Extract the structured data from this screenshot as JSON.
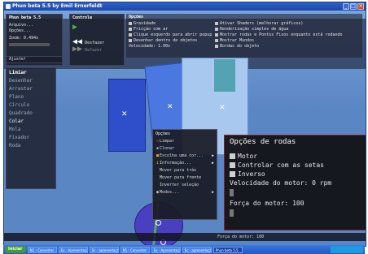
{
  "window": {
    "title": "Phun beta 5.5 by Emil Ernerfeldt"
  },
  "menu_panel": {
    "title": "Phun beta 5.5",
    "items": [
      "Arquivo...",
      "Opções..."
    ],
    "zoom": "Zoom: 0.494x"
  },
  "controls_panel": {
    "title": "Controle",
    "undo": "Desfazer",
    "redo": "Refazer"
  },
  "options_panel": {
    "title": "Opções",
    "left": [
      "Gravidade",
      "Fricção com ar",
      "Clique esquerdo para abrir popup",
      "Desenhar dentro de objetos",
      "Velocidade: 1.00x"
    ],
    "right": [
      "Ativar Shaders (melhorar gráficos)",
      "Renderização simples de água",
      "Mostrar rodas e Pontos Fixos enquanto está rodando",
      "Mostrar Mundos",
      "Bordas do objeto"
    ]
  },
  "adjust": {
    "label": "Ajuste!"
  },
  "tools": {
    "title": "Limiar",
    "items": [
      {
        "label": "Desenhar",
        "active": false
      },
      {
        "label": "Arrastar",
        "active": false
      },
      {
        "label": "Plano",
        "active": false
      },
      {
        "label": "Círculo",
        "active": false
      },
      {
        "label": "Quadrado",
        "active": false
      },
      {
        "label": "Colar",
        "active": true
      },
      {
        "label": "Mola",
        "active": false
      },
      {
        "label": "Fixador",
        "active": false
      },
      {
        "label": "Roda",
        "active": false
      }
    ]
  },
  "context_menu": {
    "title": "Opções",
    "items": [
      {
        "icon": "✕",
        "label": "Limpar",
        "arrow": ""
      },
      {
        "icon": "▪",
        "label": "Clonar",
        "arrow": ""
      },
      {
        "icon": "■",
        "label": "Escolha uma cor...",
        "arrow": "▶"
      },
      {
        "icon": "i",
        "label": "Informação...",
        "arrow": "▶"
      },
      {
        "icon": "",
        "label": "Mover para trás",
        "arrow": ""
      },
      {
        "icon": "",
        "label": "Mover para frente",
        "arrow": ""
      },
      {
        "icon": "",
        "label": "Inverter seleção",
        "arrow": ""
      },
      {
        "icon": "◉",
        "label": "Modos...",
        "arrow": "▶"
      }
    ]
  },
  "wheel_options": {
    "title": "Opções de rodas",
    "checkboxes": [
      "Motor",
      "Controlar com as setas",
      "Inverso"
    ],
    "speed_label": "Velocidade do motor: 0 rpm",
    "force_label": "Força do motor: 100"
  },
  "statusbar": {
    "text": "Força do motor: 100"
  },
  "taskbar": {
    "start": "Iniciar",
    "tasks": [
      "N1 - Converter",
      "Ex - Apresentação",
      "Sc - apresentação",
      "N1 - Converter",
      "Ex - Apresentação",
      "Sc - apresentação",
      "Phun beta 5.5"
    ],
    "active_task": 6
  }
}
